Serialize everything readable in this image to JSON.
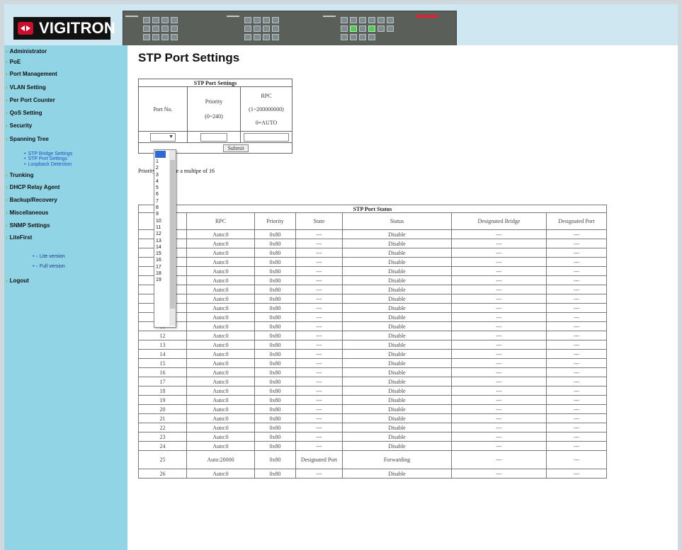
{
  "brand": "VIGITRON",
  "nav": {
    "items": [
      "Administrator",
      "PoE",
      "Port Management",
      "VLAN Setting",
      "Per Port Counter",
      "QoS Setting",
      "Security",
      "Spanning Tree",
      "Trunking",
      "DHCP Relay Agent",
      "Backup/Recovery",
      "Miscellaneous",
      "SNMP Settings",
      "LiteFirst",
      "Logout"
    ],
    "sub": [
      "STP Bridge Settings",
      "STP Port Settings",
      "Loopback Detection"
    ],
    "versions": [
      "Lite version",
      "Full version"
    ]
  },
  "page_title": "STP Port Settings",
  "settings": {
    "caption": "STP Port Settings",
    "port_header": "Port No.",
    "priority_header": "Priority",
    "priority_range": "(0~240)",
    "rpc_header": "RPC",
    "rpc_range": "(1~200000000)",
    "rpc_auto": "0=AUTO",
    "submit": "Submit",
    "note": "Priority should be a multipe of 16"
  },
  "dropdown_options": [
    "1",
    "2",
    "3",
    "4",
    "5",
    "6",
    "7",
    "8",
    "9",
    "10",
    "11",
    "12",
    "13",
    "14",
    "15",
    "16",
    "17",
    "18",
    "19"
  ],
  "status": {
    "caption": "STP Port Status",
    "headers": [
      "Port",
      "RPC",
      "Priority",
      "State",
      "Status",
      "Designated Bridge",
      "Designated Port"
    ],
    "rows": [
      [
        "1",
        "Auto:0",
        "0x80",
        "---",
        "Disable",
        "---",
        "---"
      ],
      [
        "2",
        "Auto:0",
        "0x80",
        "---",
        "Disable",
        "---",
        "---"
      ],
      [
        "3",
        "Auto:0",
        "0x80",
        "---",
        "Disable",
        "---",
        "---"
      ],
      [
        "4",
        "Auto:0",
        "0x80",
        "---",
        "Disable",
        "---",
        "---"
      ],
      [
        "5",
        "Auto:0",
        "0x80",
        "---",
        "Disable",
        "---",
        "---"
      ],
      [
        "6",
        "Auto:0",
        "0x80",
        "---",
        "Disable",
        "---",
        "---"
      ],
      [
        "7",
        "Auto:0",
        "0x80",
        "---",
        "Disable",
        "---",
        "---"
      ],
      [
        "8",
        "Auto:0",
        "0x80",
        "---",
        "Disable",
        "---",
        "---"
      ],
      [
        "9",
        "Auto:0",
        "0x80",
        "---",
        "Disable",
        "---",
        "---"
      ],
      [
        "10",
        "Auto:0",
        "0x80",
        "---",
        "Disable",
        "---",
        "---"
      ],
      [
        "11",
        "Auto:0",
        "0x80",
        "---",
        "Disable",
        "---",
        "---"
      ],
      [
        "12",
        "Auto:0",
        "0x80",
        "---",
        "Disable",
        "---",
        "---"
      ],
      [
        "13",
        "Auto:0",
        "0x80",
        "---",
        "Disable",
        "---",
        "---"
      ],
      [
        "14",
        "Auto:0",
        "0x80",
        "---",
        "Disable",
        "---",
        "---"
      ],
      [
        "15",
        "Auto:0",
        "0x80",
        "---",
        "Disable",
        "---",
        "---"
      ],
      [
        "16",
        "Auto:0",
        "0x80",
        "---",
        "Disable",
        "---",
        "---"
      ],
      [
        "17",
        "Auto:0",
        "0x80",
        "---",
        "Disable",
        "---",
        "---"
      ],
      [
        "18",
        "Auto:0",
        "0x80",
        "---",
        "Disable",
        "---",
        "---"
      ],
      [
        "19",
        "Auto:0",
        "0x80",
        "---",
        "Disable",
        "---",
        "---"
      ],
      [
        "20",
        "Auto:0",
        "0x80",
        "---",
        "Disable",
        "---",
        "---"
      ],
      [
        "21",
        "Auto:0",
        "0x80",
        "---",
        "Disable",
        "---",
        "---"
      ],
      [
        "22",
        "Auto:0",
        "0x80",
        "---",
        "Disable",
        "---",
        "---"
      ],
      [
        "23",
        "Auto:0",
        "0x80",
        "---",
        "Disable",
        "---",
        "---"
      ],
      [
        "24",
        "Auto:0",
        "0x80",
        "---",
        "Disable",
        "---",
        "---"
      ],
      [
        "25",
        "Auto:20000",
        "0x80",
        "Designated Port",
        "Forwarding",
        "---",
        "---"
      ],
      [
        "26",
        "Auto:0",
        "0x80",
        "---",
        "Disable",
        "---",
        "---"
      ]
    ]
  },
  "colors": {
    "sidebar": "#91d4e6",
    "header": "#cfe7f0",
    "port_active": "#56c95a"
  }
}
